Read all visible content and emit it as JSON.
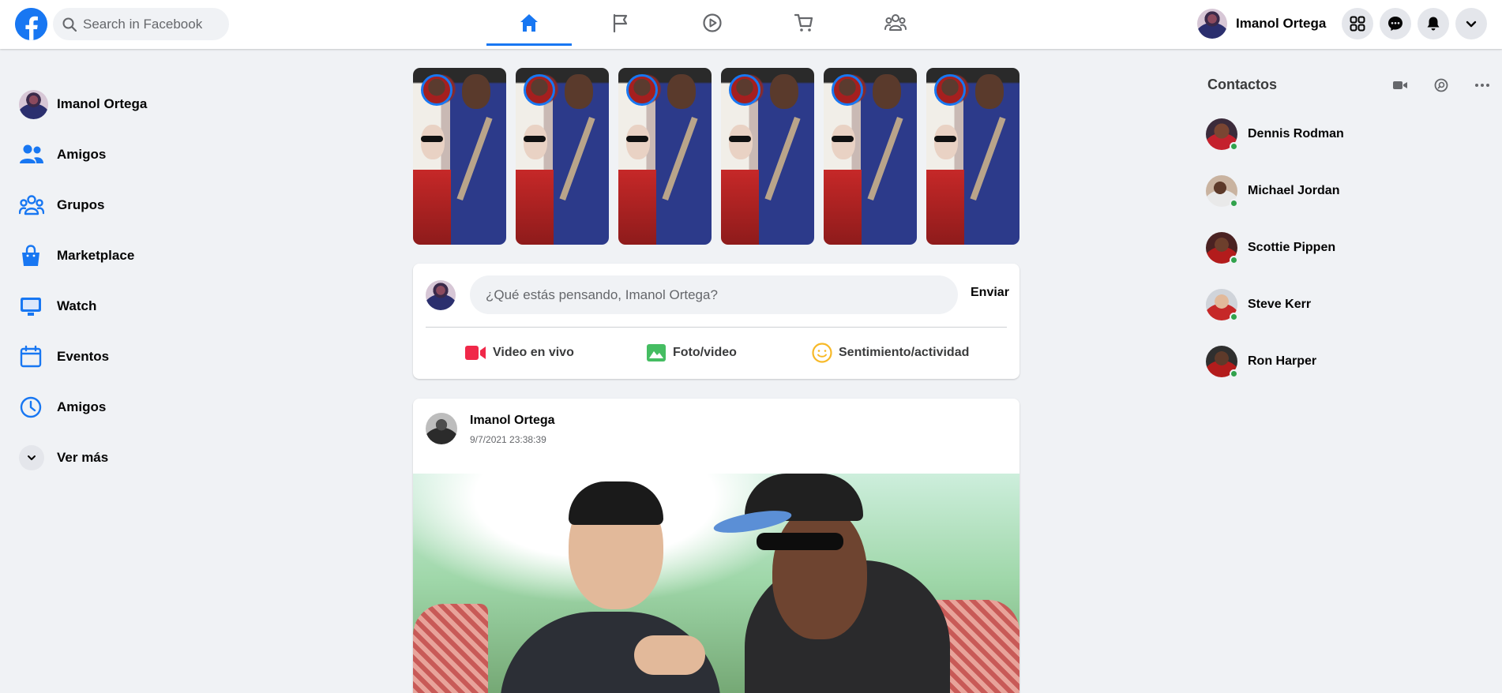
{
  "header": {
    "search_placeholder": "Search in Facebook",
    "user_name": "Imanol Ortega",
    "nav_tabs": [
      "home",
      "pages",
      "watch",
      "marketplace",
      "groups"
    ],
    "active_tab": "home",
    "icons": [
      "menu-grid-icon",
      "messenger-icon",
      "notifications-icon",
      "account-chevron-icon"
    ]
  },
  "sidebar": {
    "items": [
      {
        "label": "Imanol Ortega",
        "icon": "avatar"
      },
      {
        "label": "Amigos",
        "icon": "friends-icon"
      },
      {
        "label": "Grupos",
        "icon": "groups-icon"
      },
      {
        "label": "Marketplace",
        "icon": "marketplace-icon"
      },
      {
        "label": "Watch",
        "icon": "watch-icon"
      },
      {
        "label": "Eventos",
        "icon": "events-icon"
      },
      {
        "label": "Amigos",
        "icon": "memories-clock-icon"
      },
      {
        "label": "Ver más",
        "icon": "chevron-down-icon"
      }
    ]
  },
  "stories": {
    "count": 6
  },
  "composer": {
    "placeholder": "¿Qué estás pensando, Imanol Ortega?",
    "send_label": "Enviar",
    "actions": [
      {
        "label": "Video en vivo",
        "icon": "live-video-icon",
        "color": "#f02849"
      },
      {
        "label": "Foto/video",
        "icon": "photo-icon",
        "color": "#45bd62"
      },
      {
        "label": "Sentimiento/actividad",
        "icon": "feeling-icon",
        "color": "#f7b928"
      }
    ]
  },
  "post": {
    "author": "Imanol Ortega",
    "timestamp": "9/7/2021 23:38:39"
  },
  "contacts": {
    "title": "Contactos",
    "icons": [
      "video-call-icon",
      "search-icon",
      "more-icon"
    ],
    "items": [
      {
        "name": "Dennis Rodman",
        "online": true
      },
      {
        "name": "Michael Jordan",
        "online": true
      },
      {
        "name": "Scottie Pippen",
        "online": true
      },
      {
        "name": "Steve Kerr",
        "online": true
      },
      {
        "name": "Ron Harper",
        "online": true
      }
    ]
  },
  "colors": {
    "accent": "#1877f2",
    "background": "#f0f2f5",
    "online": "#31a24c"
  }
}
